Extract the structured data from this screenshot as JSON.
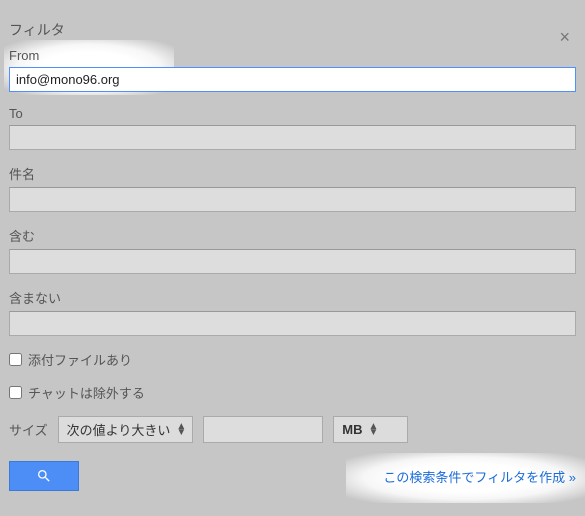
{
  "title": "フィルタ",
  "fields": {
    "from": {
      "label": "From",
      "value": "info@mono96.org"
    },
    "to": {
      "label": "To",
      "value": ""
    },
    "subject": {
      "label": "件名",
      "value": ""
    },
    "include": {
      "label": "含む",
      "value": ""
    },
    "exclude": {
      "label": "含まない",
      "value": ""
    }
  },
  "checkboxes": {
    "attachment": "添付ファイルあり",
    "chat_exclude": "チャットは除外する"
  },
  "size": {
    "label": "サイズ",
    "comparator": "次の値より大きい",
    "value": "",
    "unit": "MB"
  },
  "create_filter_link": "この検索条件でフィルタを作成 »"
}
